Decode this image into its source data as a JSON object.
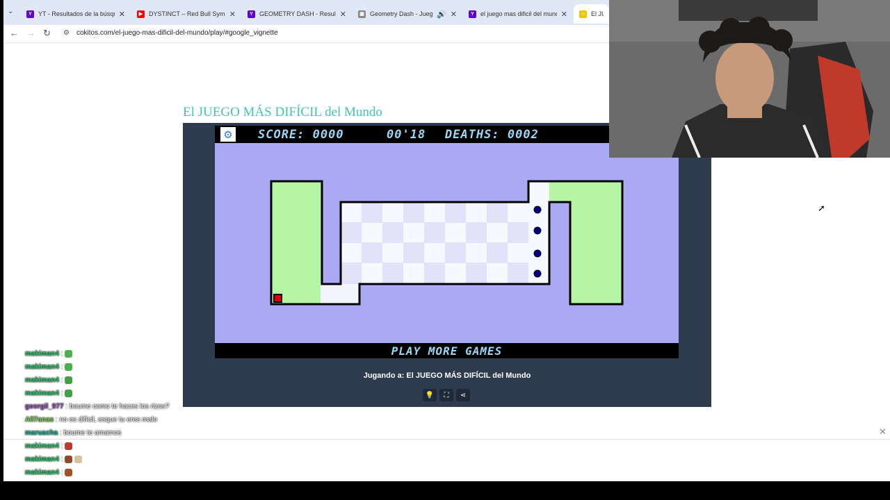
{
  "browser": {
    "tabs": [
      {
        "title": "YT - Resultados de la búsqueda",
        "icon": "yahoo-icon",
        "color": "#6001d2"
      },
      {
        "title": "DYSTINCT – Red Bull Symphonic",
        "icon": "youtube-icon",
        "color": "#ff0000"
      },
      {
        "title": "GEOMETRY DASH - Resultados",
        "icon": "yahoo-icon",
        "color": "#6001d2"
      },
      {
        "title": "Geometry Dash - Juega Gratis",
        "icon": "game-site-icon",
        "color": "#888888"
      },
      {
        "title": "el juego mas dificil del mundo",
        "icon": "yahoo-icon",
        "color": "#6001d2"
      },
      {
        "title": "El JUEGO",
        "icon": "cokitos-icon",
        "color": "#e8c800"
      }
    ],
    "url": "cokitos.com/el-juego-mas-dificil-del-mundo/play/#google_vignette"
  },
  "page": {
    "title": "El JUEGO MÁS DIFÍCIL del Mundo",
    "playing_label": "Jugando a: El JUEGO MÁS DIFÍCIL del Mundo"
  },
  "game": {
    "score_text": "SCORE: 0000",
    "timer_text": "00'18",
    "deaths_text": "DEATHS: 0002",
    "more_games_text": "PLAY MORE GAMES",
    "colors": {
      "background": "#aaaaf4",
      "safe_zone": "#b5f5a5",
      "tile_light": "#f8f8ff",
      "tile_dark": "#e0e0f8",
      "player": "#e00000",
      "enemy": "#000080"
    }
  },
  "chat": [
    {
      "user": "makiman4",
      "text": ":",
      "user_color": "#2ecc71",
      "emote": "#4caf50"
    },
    {
      "user": "makiman4",
      "text": ":",
      "user_color": "#2ecc71",
      "emote": "#4caf50"
    },
    {
      "user": "makiman4",
      "text": ":",
      "user_color": "#2ecc71",
      "emote": "#43a047"
    },
    {
      "user": "makiman4",
      "text": ":",
      "user_color": "#2ecc71",
      "emote": "#43a047"
    },
    {
      "user": "georgil_977",
      "text": ": boume como te haces los rizos?",
      "user_color": "#9b59b6",
      "emote": ""
    },
    {
      "user": "All7anas",
      "text": ": no es difícil, esque tu eres malo",
      "user_color": "#7ed957",
      "emote": ""
    },
    {
      "user": "maruacha",
      "text": ": boume te amamos",
      "user_color": "#1abc9c",
      "emote": ""
    },
    {
      "user": "makiman4",
      "text": ":",
      "user_color": "#2ecc71",
      "emote": "#c0392b"
    },
    {
      "user": "makiman4",
      "text": ":",
      "user_color": "#2ecc71",
      "emote": "#8e4a2f"
    },
    {
      "user": "makiman4",
      "text": ":",
      "user_color": "#2ecc71",
      "emote": "#a0522d"
    }
  ]
}
